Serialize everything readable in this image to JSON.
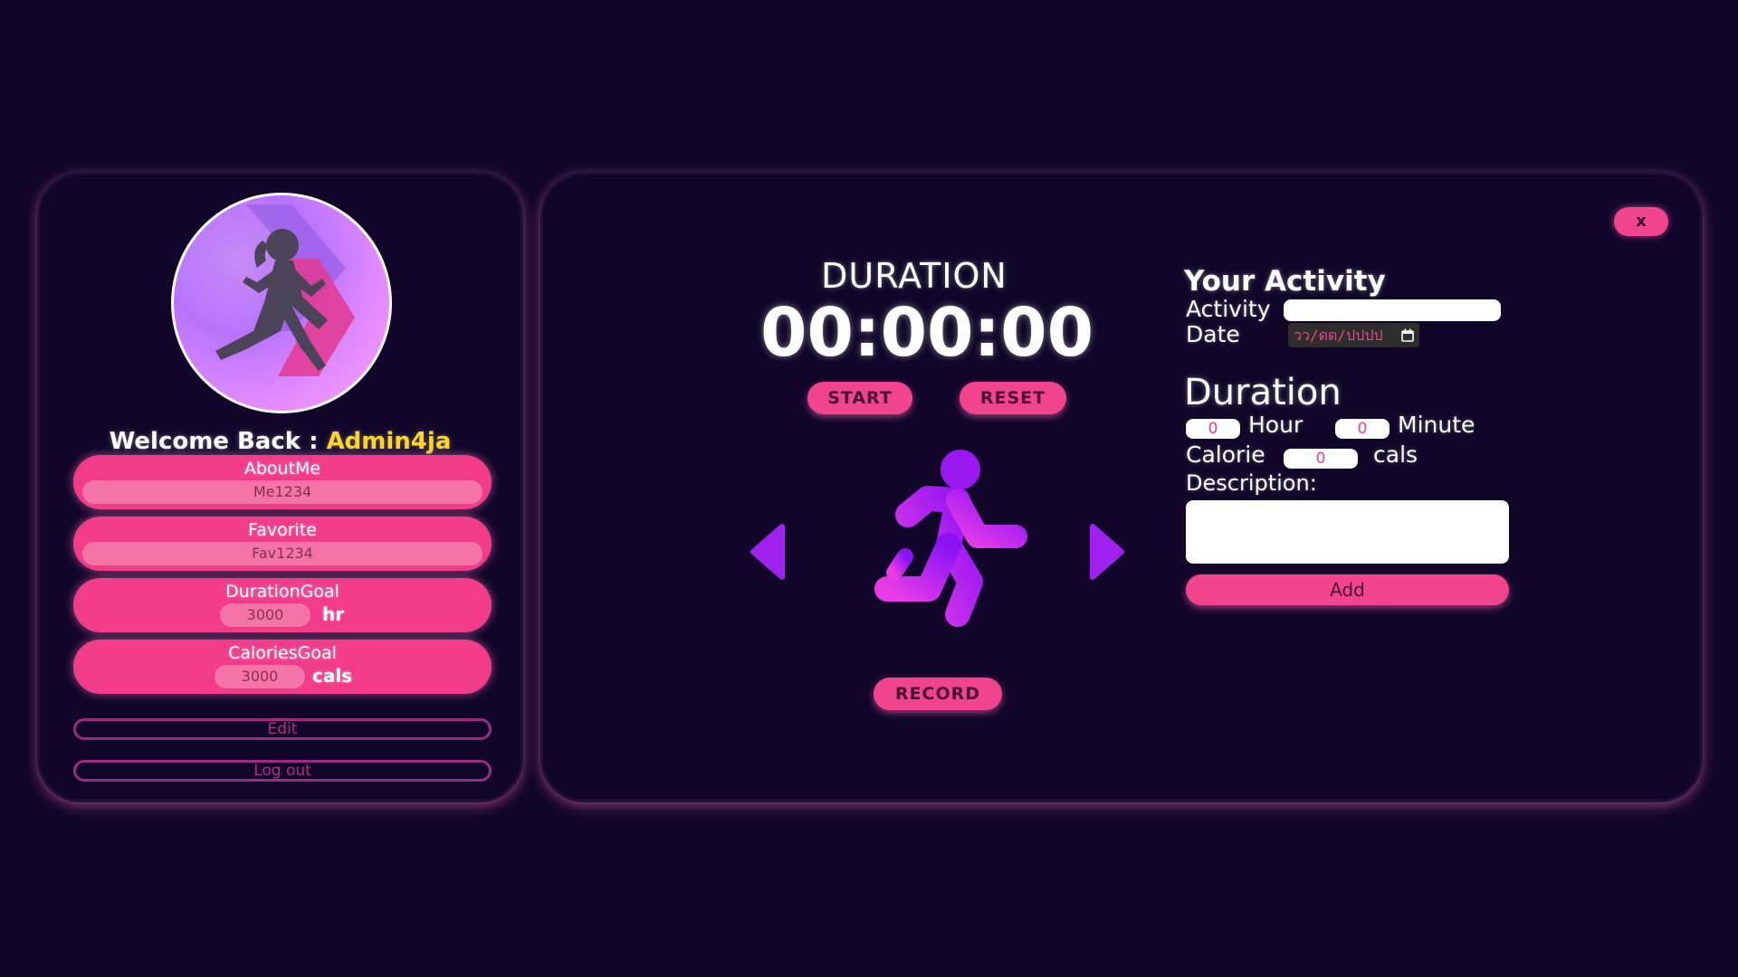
{
  "profile": {
    "welcome_prefix": "Welcome Back : ",
    "username": "Admin4ja",
    "about": {
      "title": "AboutMe",
      "value": "Me1234"
    },
    "favorite": {
      "title": "Favorite",
      "value": "Fav1234"
    },
    "duration_goal": {
      "title": "DurationGoal",
      "value": "3000",
      "unit": "hr"
    },
    "calories_goal": {
      "title": "CaloriesGoal",
      "value": "3000",
      "unit": "cals"
    },
    "edit_label": "Edit",
    "logout_label": "Log out"
  },
  "timer": {
    "title": "DURATION",
    "display": "00:00:00",
    "start_label": "START",
    "reset_label": "RESET",
    "record_label": "RECORD"
  },
  "activity_form": {
    "close_label": "x",
    "heading": "Your Activity",
    "activity_label": "Activity",
    "activity_value": "",
    "date_label": "Date",
    "date_placeholder": "วว/ดด/ปปปป",
    "duration_heading": "Duration",
    "hour_value": "0",
    "hour_label": "Hour",
    "minute_value": "0",
    "minute_label": "Minute",
    "calorie_label": "Calorie",
    "calorie_value": "0",
    "calorie_unit": "cals",
    "description_label": "Description:",
    "description_value": "",
    "add_label": "Add"
  },
  "colors": {
    "background": "#110629",
    "accent_pink": "#f2448d",
    "username_yellow": "#ffd51f",
    "runner_purple": "#a020f0"
  },
  "icons": {
    "avatar": "running-woman-avatar",
    "runner": "running-person-icon",
    "prev": "arrow-left-icon",
    "next": "arrow-right-icon",
    "calendar": "calendar-icon"
  }
}
